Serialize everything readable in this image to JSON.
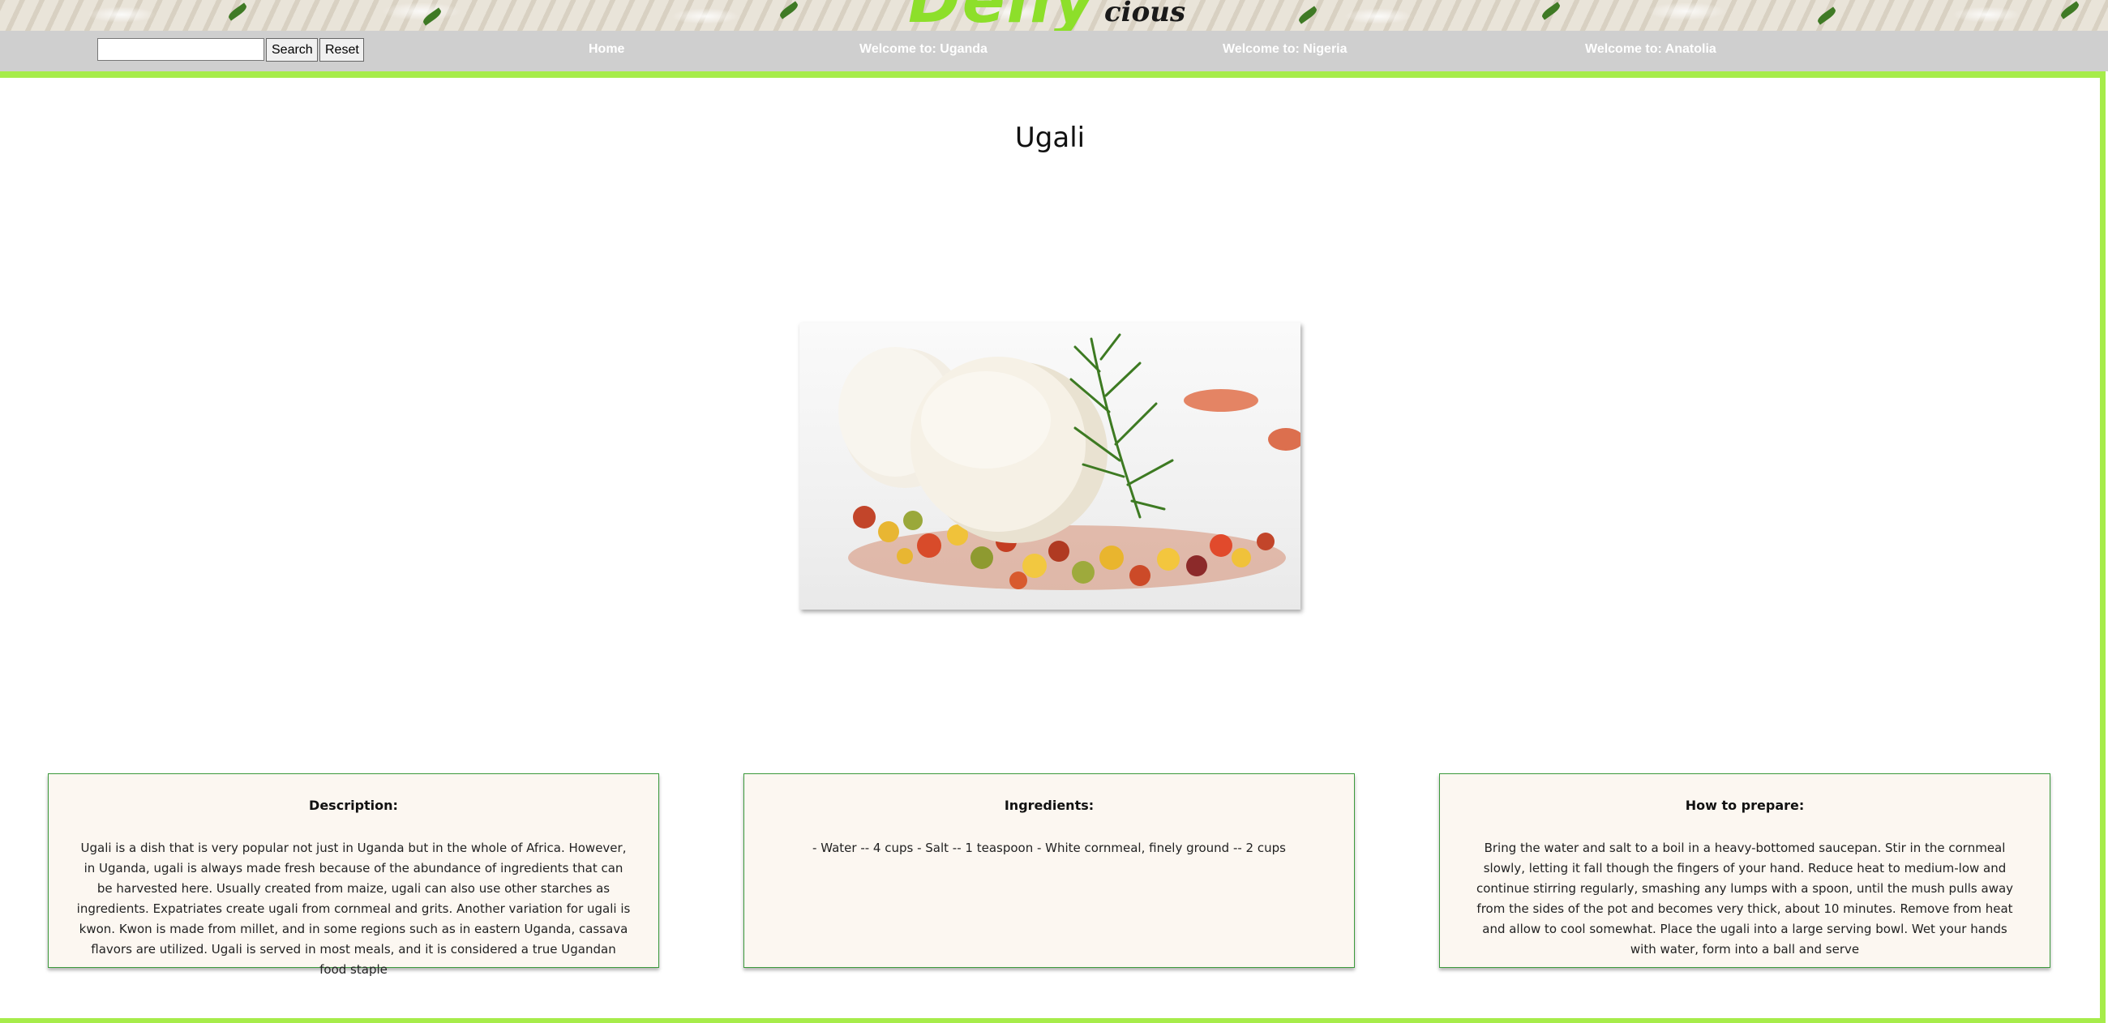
{
  "brand": {
    "logo_main": "Delly",
    "logo_sub": "cious"
  },
  "nav": {
    "search_placeholder": "",
    "search_value": "",
    "search_label": "Search",
    "reset_label": "Reset",
    "links": [
      {
        "label": "Home"
      },
      {
        "label": "Welcome to: Uganda"
      },
      {
        "label": "Welcome to: Nigeria"
      },
      {
        "label": "Welcome to: Anatolia"
      }
    ]
  },
  "dish": {
    "title": "Ugali",
    "description": {
      "heading": "Description:",
      "text": "Ugali is a dish that is very popular not just in Uganda but in the whole of Africa. However, in Uganda, ugali is always made fresh because of the abundance of ingredients that can be harvested here. Usually created from maize, ugali can also use other starches as ingredients. Expatriates create ugali from cornmeal and grits. Another variation for ugali is kwon. Kwon is made from millet, and in some regions such as in eastern Uganda, cassava flavors are utilized. Ugali is served in most meals, and it is considered a true Ugandan food staple"
    },
    "ingredients": {
      "heading": "Ingredients:",
      "text": "- Water -- 4 cups - Salt -- 1 teaspoon - White cornmeal, finely ground -- 2 cups"
    },
    "preparation": {
      "heading": "How to prepare:",
      "text": "Bring the water and salt to a boil in a heavy-bottomed saucepan. Stir in the cornmeal slowly, letting it fall though the fingers of your hand. Reduce heat to medium-low and continue stirring regularly, smashing any lumps with a spoon, until the mush pulls away from the sides of the pot and becomes very thick, about 10 minutes. Remove from heat and allow to cool somewhat. Place the ugali into a large serving bowl. Wet your hands with water, form into a ball and serve"
    }
  },
  "colors": {
    "accent_green": "#a6ec4a",
    "logo_green": "#8ddf2a",
    "nav_gray": "#cfcfcf",
    "card_bg": "#fcf7f1",
    "card_border": "#3c9a3c"
  }
}
